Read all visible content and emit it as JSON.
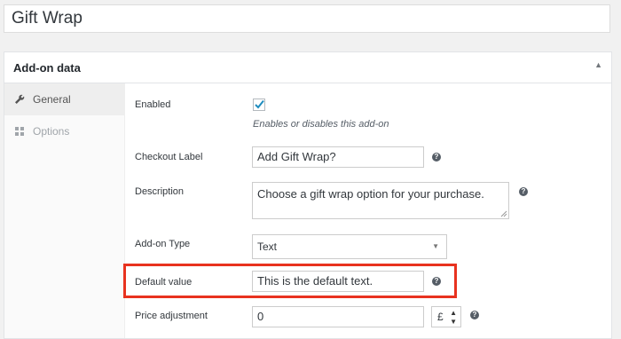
{
  "product_title": "Gift Wrap",
  "panel": {
    "title": "Add-on data",
    "collapse_icon": "triangle-up-icon"
  },
  "tabs": [
    {
      "label": "General",
      "icon": "wrench-icon",
      "active": true
    },
    {
      "label": "Options",
      "icon": "grid-icon",
      "active": false
    }
  ],
  "fields": {
    "enabled": {
      "label": "Enabled",
      "checked": true,
      "description": "Enables or disables this add-on"
    },
    "checkout_label": {
      "label": "Checkout Label",
      "value": "Add Gift Wrap?"
    },
    "description": {
      "label": "Description",
      "value": "Choose a gift wrap option for your purchase."
    },
    "addon_type": {
      "label": "Add-on Type",
      "value": "Text"
    },
    "default_value": {
      "label": "Default value",
      "value": "This is the default text."
    },
    "price_adjustment": {
      "label": "Price adjustment",
      "value": "0",
      "currency": "£"
    }
  },
  "colors": {
    "highlight": "#e8321f",
    "accent": "#0073aa"
  }
}
